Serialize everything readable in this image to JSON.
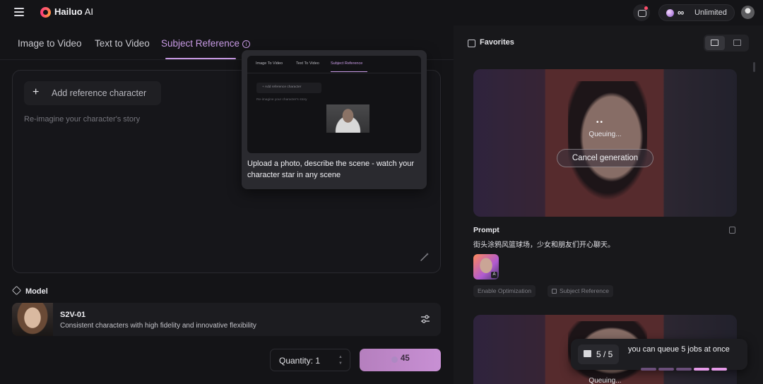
{
  "app": {
    "brand": "Hailuo",
    "brand_suffix": "AI",
    "plan": "Unlimited",
    "infinity": "∞"
  },
  "tabs": [
    {
      "label": "Image to Video",
      "active": false
    },
    {
      "label": "Text to Video",
      "active": false
    },
    {
      "label": "Subject Reference",
      "active": true
    }
  ],
  "editor": {
    "add_reference_label": "Add reference character",
    "plus": "+",
    "placeholder": "Re-imagine your character's story"
  },
  "tooltip": {
    "preview_tabs": [
      "Image To Video",
      "Text To Video",
      "Subject Reference"
    ],
    "preview_add": "+ Add reference character",
    "preview_hint": "Re-imagine your character's story",
    "text": "Upload a photo, describe the scene - watch your character star in any scene"
  },
  "model": {
    "section_label": "Model",
    "name": "S2V-01",
    "description": "Consistent characters with high fidelity and innovative flexibility"
  },
  "generate": {
    "quantity_label": "Quantity: 1",
    "stepper_up": "▲",
    "stepper_down": "▼",
    "cost": "45"
  },
  "favorites": {
    "label": "Favorites"
  },
  "feed": {
    "queue_status": "Queuing...",
    "loading_dots": "••",
    "cancel_label": "Cancel generation",
    "prompt_title": "Prompt",
    "prompt_text": "街头涂鸦风篮球场，少女和朋友们开心聊天。",
    "chips": [
      "Enable Optimization",
      "Subject Reference"
    ],
    "second_status": "Queuing..."
  },
  "toast": {
    "count": "5 / 5",
    "message": "you can queue 5 jobs at once",
    "bar_colors": [
      "#6b4f7a",
      "#6b4f7a",
      "#6b4f7a",
      "#e59ae8",
      "#e59ae8",
      "#5a4868"
    ]
  },
  "colors": {
    "accent": "#c99be6",
    "button_gradient_start": "#b57fbe",
    "button_gradient_end": "#c890d4"
  }
}
